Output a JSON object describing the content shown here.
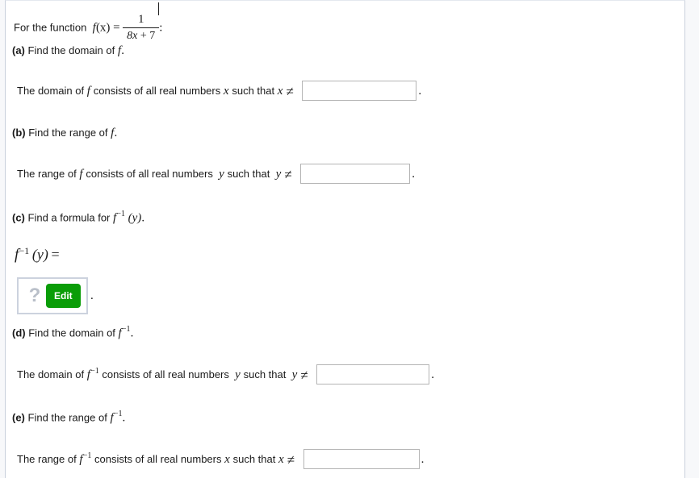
{
  "problem": {
    "intro_prefix": "For the function",
    "function_name": "f",
    "function_arg": "(x)",
    "equals": "=",
    "fraction": {
      "numerator": "1",
      "denominator_coefficient": "8",
      "denominator_variable": "x",
      "denominator_plus": "+",
      "denominator_constant": "7",
      "denominator_text": "8x + 7"
    },
    "intro_suffix": ":",
    "full_function": "f(x) = 1/(8x + 7)"
  },
  "parts": {
    "a": {
      "label": "(a)",
      "prompt_before": "Find the domain of",
      "prompt_symbol": "f",
      "prompt_after": ".",
      "statement_before": "The domain of",
      "statement_symbol": "f",
      "statement_middle": "consists of all real numbers",
      "statement_var": "x",
      "statement_such_that": "such that",
      "statement_var2": "x",
      "neq_sign": "≠",
      "answer_value": "",
      "answer_placeholder": "",
      "trailing_period": "."
    },
    "b": {
      "label": "(b)",
      "prompt_before": "Find the range of",
      "prompt_symbol": "f",
      "prompt_after": ".",
      "statement_before": "The range of",
      "statement_symbol": "f",
      "statement_middle": "consists of all real numbers",
      "statement_var": "y",
      "statement_such_that": "such that",
      "statement_var2": "y",
      "neq_sign": "≠",
      "answer_value": "",
      "answer_placeholder": "",
      "trailing_period": "."
    },
    "c": {
      "label": "(c)",
      "prompt_before": "Find a formula for",
      "prompt_symbol": "f",
      "prompt_sup": "−1",
      "prompt_arg": "(y)",
      "prompt_after": ".",
      "formula_symbol": "f",
      "formula_sup": "−1",
      "formula_arg": "(y)",
      "formula_equals": "=",
      "editor": {
        "placeholder_glyph": "?",
        "edit_label": "Edit",
        "trailing_period": ".",
        "edit_button_color": "#0a9d08",
        "box_border_color": "#ccd2de",
        "placeholder_color": "#b9bfc9"
      }
    },
    "d": {
      "label": "(d)",
      "prompt_before": "Find the domain of",
      "prompt_symbol": "f",
      "prompt_sup": "−1",
      "prompt_after": ".",
      "statement_before": "The domain of",
      "statement_symbol": "f",
      "statement_sup": "−1",
      "statement_middle": "consists of all real numbers",
      "statement_var": "y",
      "statement_such_that": "such that",
      "statement_var2": "y",
      "neq_sign": "≠",
      "answer_value": "",
      "answer_placeholder": "",
      "trailing_period": "."
    },
    "e": {
      "label": "(e)",
      "prompt_before": "Find the range of",
      "prompt_symbol": "f",
      "prompt_sup": "−1",
      "prompt_after": ".",
      "statement_before": "The range of",
      "statement_symbol": "f",
      "statement_sup": "−1",
      "statement_middle": "consists of all real numbers",
      "statement_var": "x",
      "statement_such_that": "such that",
      "statement_var2": "x",
      "neq_sign": "≠",
      "answer_value": "",
      "answer_placeholder": "",
      "trailing_period": "."
    }
  },
  "theme": {
    "page_background": "#ffffff",
    "outer_background": "#f7f8fa",
    "frame_border": "#c9d0dc",
    "input_border": "#b4b4b4",
    "text_color": "#1a1a1a"
  }
}
